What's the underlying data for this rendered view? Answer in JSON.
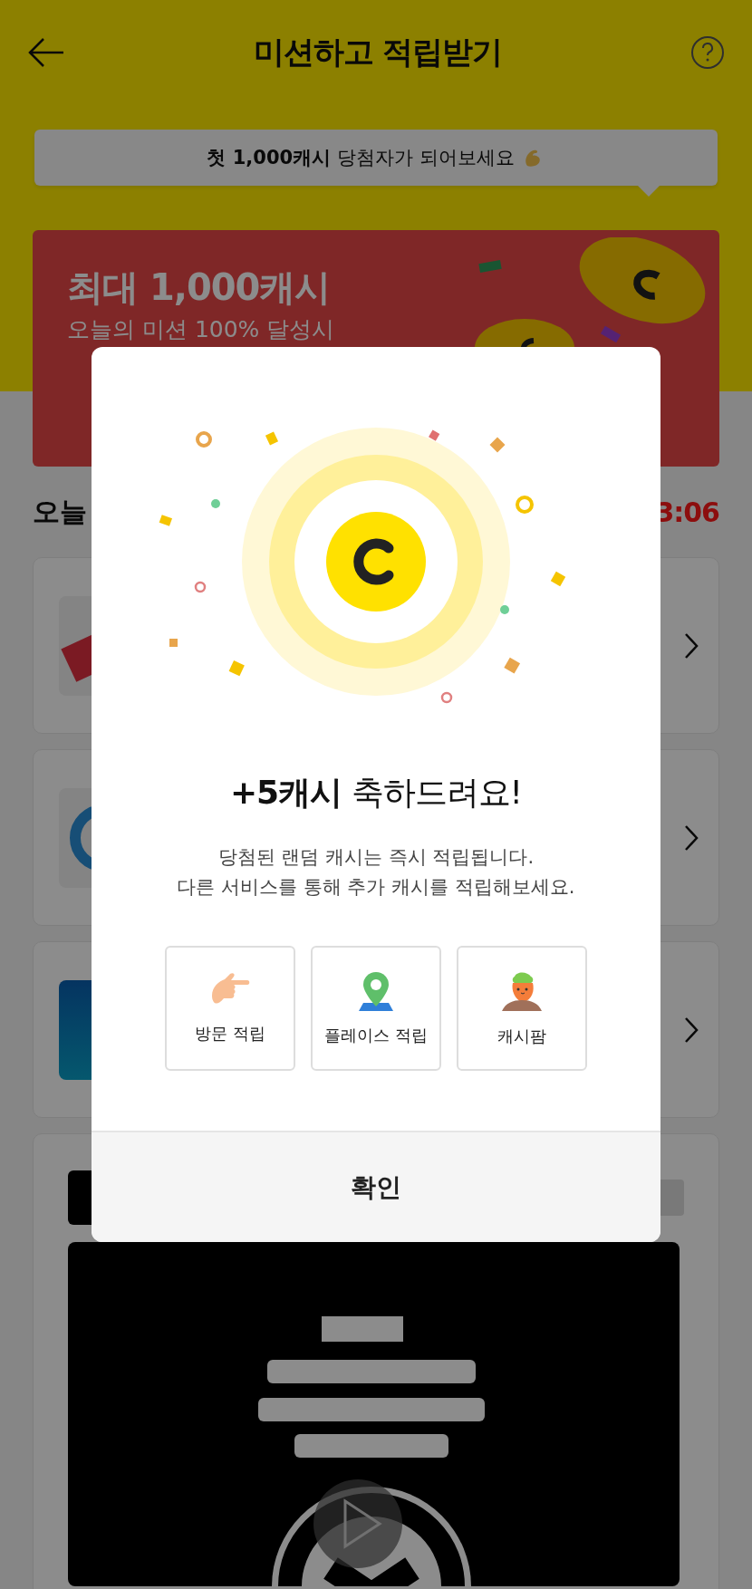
{
  "header": {
    "title": "미션하고 적립받기"
  },
  "tooltip": {
    "text": "**첫 1,000캐시** 당첨자가 되어보세요"
  },
  "banner": {
    "title": "최대 1,000캐시",
    "subtitle": "오늘의 미션 100% 달성시"
  },
  "section": {
    "title": "오늘",
    "timer": "3:06"
  },
  "missions": [
    {
      "kind": "tag"
    },
    {
      "kind": "ring"
    },
    {
      "kind": "tile"
    }
  ],
  "modal": {
    "headline": "**+5캐시** 축하드려요!",
    "lines": [
      "당첨된 랜덤 캐시는 즉시 적립됩니다.",
      "다른 서비스를 통해 추가 캐시를 적립해보세요."
    ],
    "shortcuts": [
      {
        "kind": "visit",
        "label": "방문 적립"
      },
      {
        "kind": "place",
        "label": "플레이스 적립"
      },
      {
        "kind": "farm",
        "label": "캐시팜"
      }
    ],
    "confirm": "확인"
  }
}
